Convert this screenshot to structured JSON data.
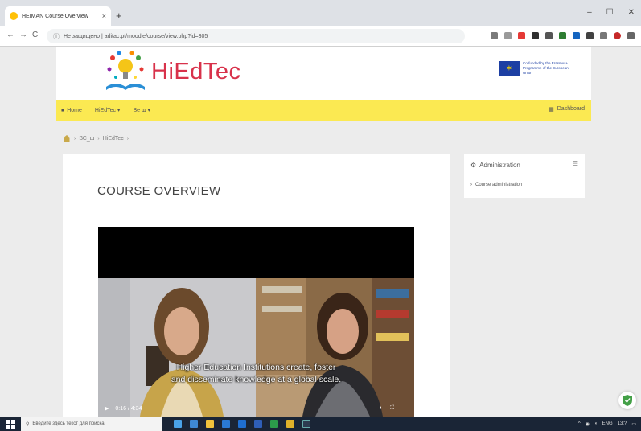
{
  "browser": {
    "tab_title": "HEIMAN Course Overview",
    "tab_close": "×",
    "new_tab": "+",
    "url": "Не защищено | aditac.pt/moodle/course/view.php?id=305",
    "controls": [
      "–",
      "☐",
      "✕"
    ],
    "nav": [
      "←",
      "→",
      "C"
    ]
  },
  "site": {
    "logo_text": "HiEdTec",
    "eu_text": "Co-funded by the Erasmus+ Programme of the European Union"
  },
  "navbar": {
    "home": "Home",
    "item1": "HiEdTec ▾",
    "item2": "Ве ш ▾",
    "right": "Dashboard"
  },
  "breadcrumb": {
    "items": [
      "›",
      "ВС_ш",
      "›",
      "HiEdTec",
      "›"
    ]
  },
  "main": {
    "title": "COURSE OVERVIEW",
    "video": {
      "subtitle_line1": "Higher Education Institutions create, foster",
      "subtitle_line2": "and disseminate knowledge at a global scale.",
      "time": "0:16 / 4:34",
      "play": "▶"
    }
  },
  "sidebar": {
    "title": "Administration",
    "collapse": "☰",
    "item": "Course administration"
  },
  "taskbar": {
    "search_placeholder": "Введите здесь текст для поиска",
    "lang": "ENG",
    "time": "13:?",
    "date": "??.??.????"
  },
  "colors": {
    "brand_red": "#d8324b",
    "navbar_yellow": "#fbe952",
    "eu_blue": "#1d3fa3"
  }
}
